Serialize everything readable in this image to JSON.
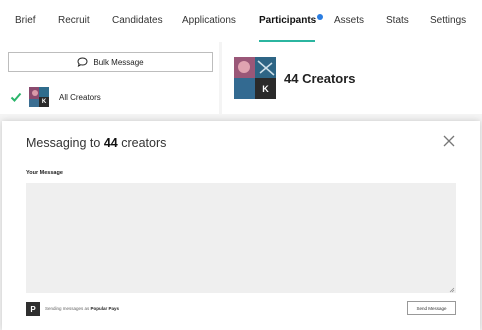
{
  "tabs": [
    {
      "label": "Brief"
    },
    {
      "label": "Recruit"
    },
    {
      "label": "Candidates"
    },
    {
      "label": "Applications"
    },
    {
      "label": "Participants",
      "active": true,
      "has_notification": true
    },
    {
      "label": "Assets"
    },
    {
      "label": "Stats"
    },
    {
      "label": "Settings"
    }
  ],
  "left_panel": {
    "bulk_message_label": "Bulk Message",
    "bulk_message_icon": "chat-bubble-icon",
    "all_creators_label": "All Creators",
    "all_creators_checked": true,
    "avatar_initial": "K"
  },
  "header": {
    "creators_count_label": "44 Creators",
    "avatar_initial": "K"
  },
  "modal": {
    "title_prefix": "Messaging to",
    "title_count": "44",
    "title_suffix": "creators",
    "message_label": "Your Message",
    "message_value": "",
    "footer_logo": "P",
    "footer_prefix": "Sending messages as",
    "footer_brand": "Popular Pays",
    "send_label": "Send Message"
  },
  "colors": {
    "accent_underline": "#2bb5a0",
    "notification_dot": "#2a7de1",
    "check_green": "#2bb56b"
  }
}
